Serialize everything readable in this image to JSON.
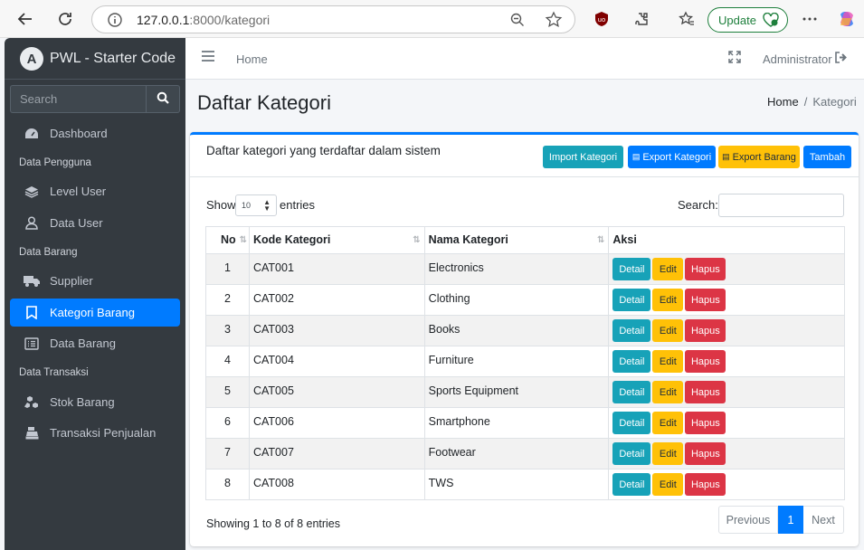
{
  "browser": {
    "url_host": "127.0.0.1",
    "url_rest": ":8000/kategori",
    "update_label": "Update"
  },
  "sidebar": {
    "brand": "PWL - Starter Code",
    "search_placeholder": "Search",
    "items": [
      {
        "label": "Dashboard",
        "icon": "dashboard-icon"
      },
      {
        "header": "Data Pengguna"
      },
      {
        "label": "Level User",
        "icon": "layers-icon"
      },
      {
        "label": "Data User",
        "icon": "user-icon"
      },
      {
        "header": "Data Barang"
      },
      {
        "label": "Supplier",
        "icon": "truck-icon"
      },
      {
        "label": "Kategori Barang",
        "icon": "bookmark-icon",
        "active": true
      },
      {
        "label": "Data Barang",
        "icon": "list-icon"
      },
      {
        "header": "Data Transaksi"
      },
      {
        "label": "Stok Barang",
        "icon": "cubes-icon"
      },
      {
        "label": "Transaksi Penjualan",
        "icon": "cash-register-icon"
      }
    ]
  },
  "topbar": {
    "home": "Home",
    "user": "Administrator"
  },
  "page": {
    "title": "Daftar Kategori",
    "breadcrumb": [
      "Home",
      "Kategori"
    ]
  },
  "card": {
    "title": "Daftar kategori yang terdaftar dalam sistem",
    "buttons": {
      "import": "Import Kategori",
      "export_kategori": "Export Kategori",
      "export_barang": "Export Barang",
      "tambah": "Tambah"
    },
    "show_label": "Show",
    "entries_value": "10",
    "entries_label": "entries",
    "search_label": "Search:",
    "table": {
      "headers": [
        "No",
        "Kode Kategori",
        "Nama Kategori",
        "Aksi"
      ],
      "rows": [
        [
          "1",
          "CAT001",
          "Electronics"
        ],
        [
          "2",
          "CAT002",
          "Clothing"
        ],
        [
          "3",
          "CAT003",
          "Books"
        ],
        [
          "4",
          "CAT004",
          "Furniture"
        ],
        [
          "5",
          "CAT005",
          "Sports Equipment"
        ],
        [
          "6",
          "CAT006",
          "Smartphone"
        ],
        [
          "7",
          "CAT007",
          "Footwear"
        ],
        [
          "8",
          "CAT008",
          "TWS"
        ]
      ],
      "action_labels": {
        "detail": "Detail",
        "edit": "Edit",
        "hapus": "Hapus"
      }
    },
    "info": "Showing 1 to 8 of 8 entries",
    "pagination": {
      "prev": "Previous",
      "current": "1",
      "next": "Next"
    }
  },
  "colors": {
    "primary": "#007bff",
    "info": "#17a2b8",
    "warning": "#ffc107",
    "danger": "#dc3545",
    "sidebar_bg": "#343a40"
  }
}
